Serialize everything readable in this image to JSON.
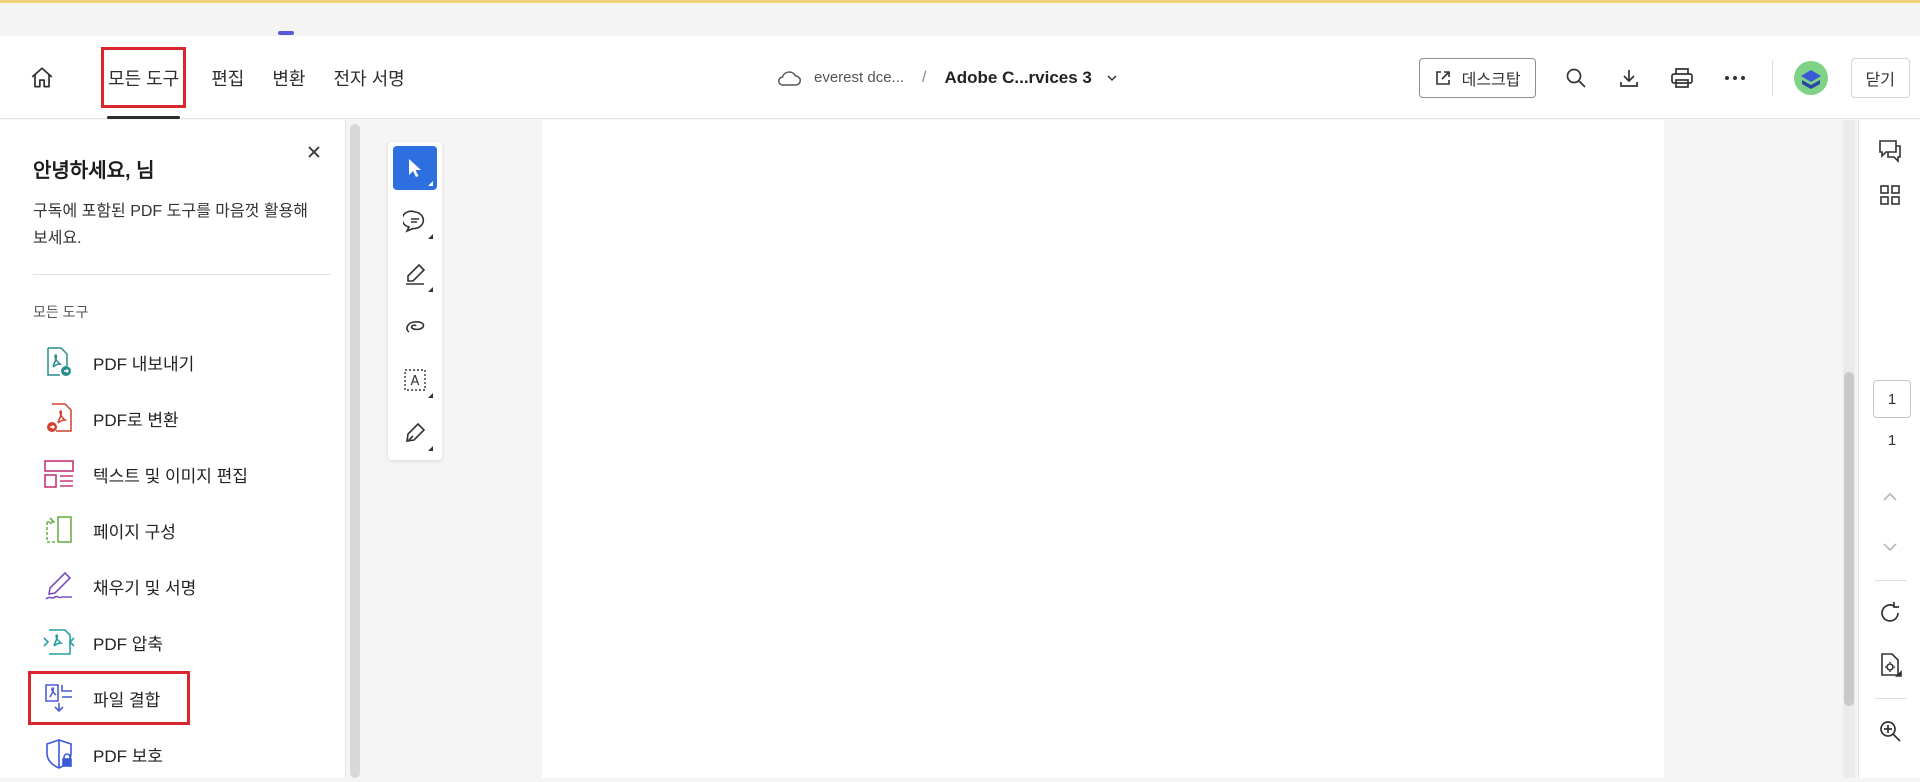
{
  "header": {
    "tabs": [
      {
        "label": "모든 도구",
        "active": true
      },
      {
        "label": "편집"
      },
      {
        "label": "변환"
      },
      {
        "label": "전자 서명"
      }
    ],
    "cloud_label": "everest dce...",
    "separator": "/",
    "doc_name": "Adobe C...rvices 3",
    "desktop_label": "데스크탑",
    "close_label": "닫기"
  },
  "panel": {
    "greeting": "안녕하세요, 님",
    "subtitle": "구독에 포함된 PDF 도구를 마음껏 활용해 보세요.",
    "section_label": "모든 도구",
    "tools": [
      {
        "label": "PDF 내보내기",
        "icon": "export-pdf-icon"
      },
      {
        "label": "PDF로 변환",
        "icon": "create-pdf-icon"
      },
      {
        "label": "텍스트 및 이미지 편집",
        "icon": "edit-text-image-icon"
      },
      {
        "label": "페이지 구성",
        "icon": "organize-pages-icon"
      },
      {
        "label": "채우기 및 서명",
        "icon": "fill-sign-icon"
      },
      {
        "label": "PDF 압축",
        "icon": "compress-pdf-icon"
      },
      {
        "label": "파일 결합",
        "icon": "combine-files-icon"
      },
      {
        "label": "PDF 보호",
        "icon": "protect-pdf-icon"
      }
    ]
  },
  "quick_tools": [
    "select-cursor-icon",
    "comment-icon",
    "highlight-icon",
    "draw-icon",
    "text-box-icon",
    "sign-icon"
  ],
  "page_nav": {
    "current": "1",
    "total": "1"
  },
  "colors": {
    "accent": "#2e6fe0",
    "highlight_box": "#d9272e",
    "top_strip": "#f0d27a"
  }
}
